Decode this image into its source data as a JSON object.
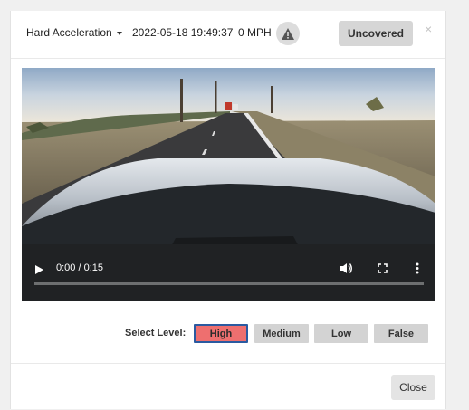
{
  "header": {
    "event_type": "Hard Acceleration",
    "timestamp": "2022-05-18 19:49:37",
    "speed": "0 MPH",
    "uncovered_label": "Uncovered",
    "close_symbol": "×"
  },
  "video": {
    "time_display": "0:00 / 0:15",
    "progress": 0
  },
  "level": {
    "label": "Select Level:",
    "options": [
      "High",
      "Medium",
      "Low",
      "False"
    ],
    "selected": "High"
  },
  "footer": {
    "close_label": "Close"
  },
  "colors": {
    "selected_level": "#ee6f6f",
    "selected_border": "#2b5aa0"
  }
}
